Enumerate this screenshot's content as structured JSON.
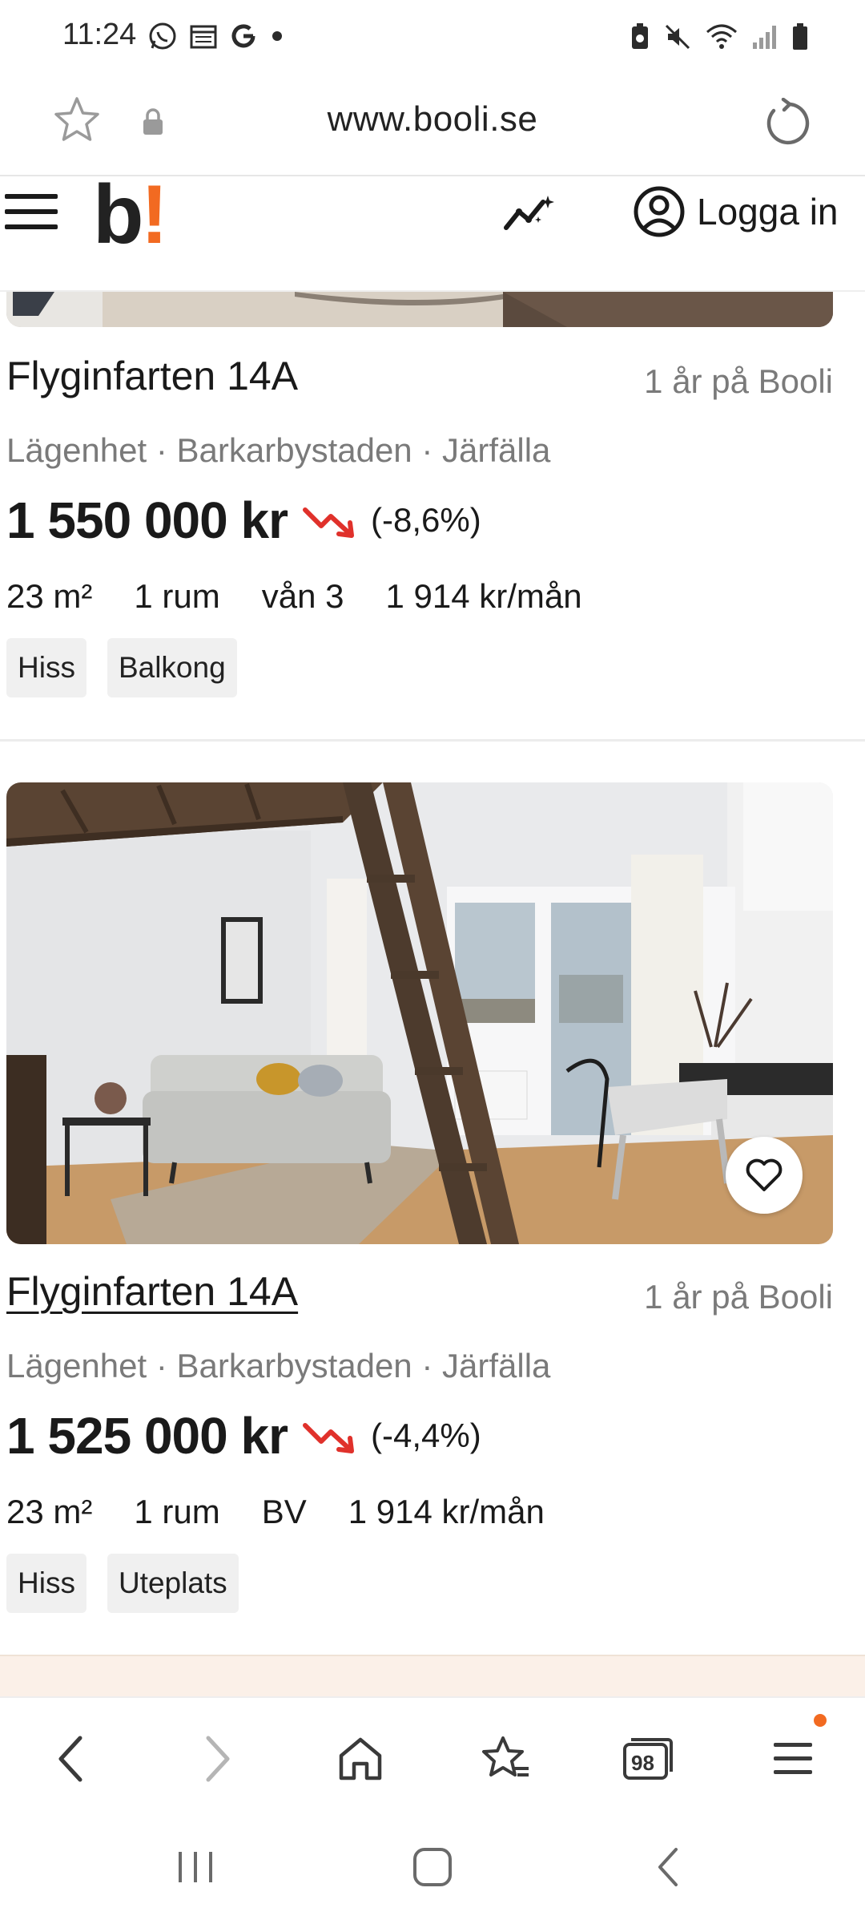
{
  "status_bar": {
    "time": "11:24",
    "left_icons": [
      "whatsapp-icon",
      "calendar-icon",
      "google-icon",
      "dot-icon"
    ],
    "right_icons": [
      "battery-saver-icon",
      "mute-icon",
      "wifi-icon",
      "signal-icon",
      "battery-icon"
    ]
  },
  "browser": {
    "url": "www.booli.se",
    "icons": [
      "star-icon",
      "lock-icon",
      "reload-icon"
    ]
  },
  "site_header": {
    "logo_text": "b",
    "logo_accent": "!",
    "login_label": "Logga in"
  },
  "listings": [
    {
      "title": "Flyginfarten 14A",
      "age": "1 år på Booli",
      "subtitle": "Lägenhet · Barkarbystaden · Järfälla",
      "price": "1 550 000 kr",
      "price_change": "(-8,6%)",
      "facts": [
        "23 m²",
        "1 rum",
        "vån 3",
        "1 914 kr/mån"
      ],
      "tags": [
        "Hiss",
        "Balkong"
      ]
    },
    {
      "title": "Flyginfarten 14A",
      "age": "1 år på Booli",
      "subtitle": "Lägenhet · Barkarbystaden · Järfälla",
      "price": "1 525 000 kr",
      "price_change": "(-4,4%)",
      "facts": [
        "23 m²",
        "1 rum",
        "BV",
        "1 914 kr/mån"
      ],
      "tags": [
        "Hiss",
        "Uteplats"
      ]
    }
  ],
  "browser_toolbar": {
    "tab_count": "98",
    "icons": [
      "back-icon",
      "forward-icon",
      "home-icon",
      "bookmarks-icon",
      "tabs-icon",
      "menu-icon"
    ]
  },
  "system_nav": {
    "icons": [
      "recents-icon",
      "home-icon",
      "back-icon"
    ]
  },
  "colors": {
    "brand_accent": "#f26a21",
    "price_down": "#e0312b",
    "muted_text": "#7a7a7a"
  }
}
